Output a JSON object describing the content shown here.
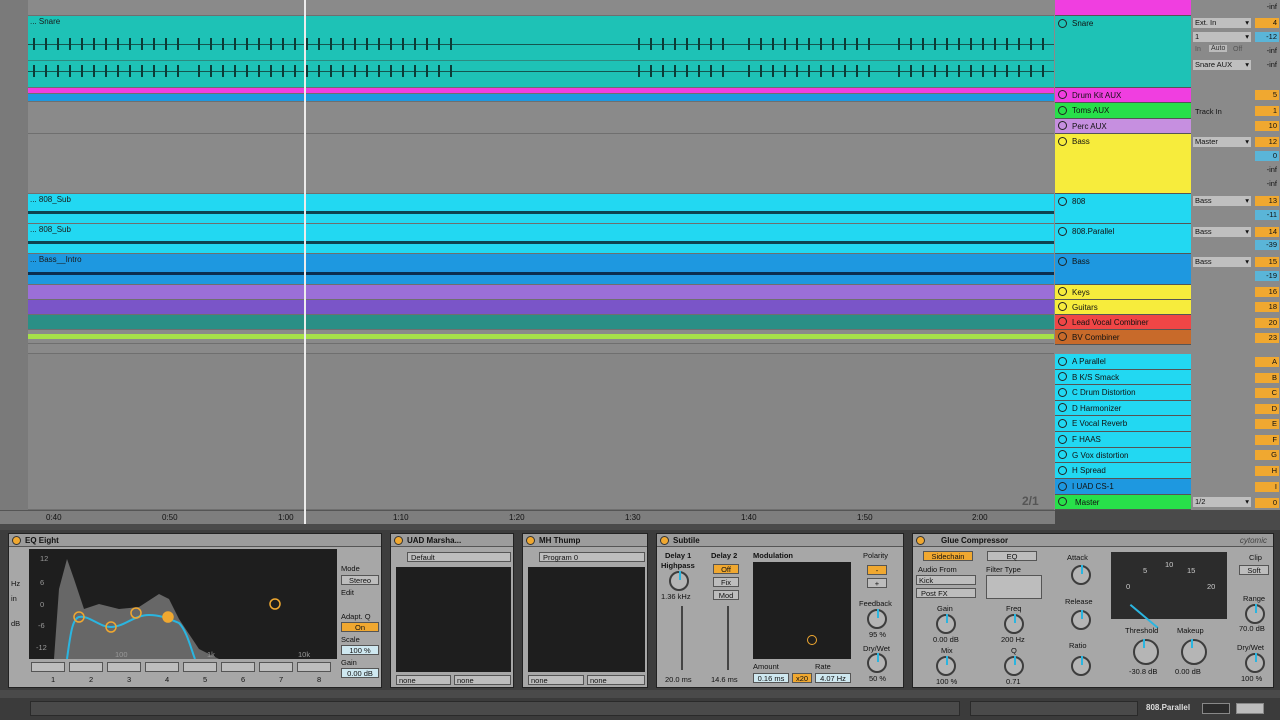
{
  "arrangement": {
    "ruler_ticks": [
      "0:40",
      "0:50",
      "1:00",
      "1:10",
      "1:20",
      "1:30",
      "1:40",
      "1:50",
      "2:00"
    ],
    "clip_names": {
      "snare": "... Snare",
      "sub1": "... 808_Sub",
      "sub2": "... 808_Sub",
      "bass": "... Bass__Intro"
    },
    "page_indicator": "2/1"
  },
  "tracks": [
    {
      "name": "Snare",
      "color": "#f03ee0"
    },
    {
      "name": "Snare",
      "color": "#1ec2b6"
    },
    {
      "name": "Drum Kit AUX",
      "color": "#f03ee0"
    },
    {
      "name": "Toms AUX",
      "color": "#28e04a"
    },
    {
      "name": "Perc AUX",
      "color": "#c68fe0"
    },
    {
      "name": "Bass",
      "color": "#f7ec3c"
    },
    {
      "name": "808",
      "color": "#22d8f2"
    },
    {
      "name": "808.Parallel",
      "color": "#22d8f2"
    },
    {
      "name": "Bass",
      "color": "#1e98e0"
    },
    {
      "name": "Keys",
      "color": "#f7ec3c"
    },
    {
      "name": "Guitars",
      "color": "#f7ec3c"
    },
    {
      "name": "Lead Vocal Combiner",
      "color": "#f04646"
    },
    {
      "name": "BV Combiner",
      "color": "#c86a2a"
    }
  ],
  "returns": [
    {
      "name": "A Parallel",
      "vol": "A"
    },
    {
      "name": "B K/S Smack",
      "vol": "B"
    },
    {
      "name": "C Drum Distortion",
      "vol": "C"
    },
    {
      "name": "D Harmonizer",
      "vol": "D"
    },
    {
      "name": "E Vocal Reverb",
      "vol": "E"
    },
    {
      "name": "F HAAS",
      "vol": "F"
    },
    {
      "name": "G Vox distortion",
      "vol": "G"
    },
    {
      "name": "H Spread",
      "vol": "H"
    },
    {
      "name": "I UAD CS-1",
      "vol": "I"
    }
  ],
  "master": {
    "name": "Master",
    "out": "1/2",
    "vol": "0"
  },
  "io": {
    "snare_in": "Ext. In",
    "snare_ch": "1",
    "monitor": [
      "In",
      "Auto",
      "Off"
    ],
    "snare_out": "Snare AUX",
    "toms_in": "Track In",
    "bass_out": "Master",
    "bass_808": "Bass",
    "bass_par": "Bass",
    "bass_bass": "Bass"
  },
  "volumes": [
    "-inf",
    "4",
    "-12",
    "-inf",
    "-inf",
    "5",
    "1",
    "10",
    "12",
    "0",
    "-inf",
    "-inf",
    "13",
    "-11",
    "14",
    "-39",
    "15",
    "-19",
    "16",
    "18",
    "20",
    "23"
  ],
  "devices": {
    "eq": {
      "title": "EQ Eight",
      "mode_label": "Mode",
      "mode": "Stereo",
      "edit": "Edit",
      "adapt": "Adapt. Q",
      "on": "On",
      "scale_label": "Scale",
      "scale": "100 %",
      "gain_label": "Gain",
      "gain": "0.00 dB",
      "y_labels": [
        "12",
        "6",
        "0",
        "-6",
        "-12"
      ],
      "x_labels": [
        "100",
        "1k",
        "10k"
      ],
      "bands": [
        "1",
        "2",
        "3",
        "4",
        "5",
        "6",
        "7",
        "8"
      ],
      "side": [
        "Hz",
        "in",
        "dB"
      ]
    },
    "uad": {
      "title": "UAD Marsha...",
      "preset": "Default",
      "none1": "none",
      "none2": "none"
    },
    "thump": {
      "title": "MH Thump",
      "preset": "Program 0",
      "none1": "none",
      "none2": "none"
    },
    "subtile": {
      "title": "Subtile",
      "d1": "Delay 1",
      "hp": "Highpass",
      "hp_val": "1.36 kHz",
      "d2": "Delay 2",
      "off": "Off",
      "fix": "Fix",
      "mod_btn": "Mod",
      "mod": "Modulation",
      "polarity": "Polarity",
      "minus": "-",
      "plus": "+",
      "feedback": "Feedback",
      "fb_val": "95 %",
      "drywet": "Dry/Wet",
      "dw_val": "50 %",
      "amount": "Amount",
      "amount_val": "0.16 ms",
      "amount_x": "x20",
      "rate": "Rate",
      "rate_val": "4.07 Hz",
      "d1_ms": "20.0 ms",
      "d2_ms": "14.6 ms"
    },
    "glue": {
      "title": "Glue Compressor",
      "brand": "cytomic",
      "sidechain": "Sidechain",
      "eq": "EQ",
      "audio_from": "Audio From",
      "kick": "Kick",
      "postfx": "Post FX",
      "filter_type": "Filter Type",
      "gain": "Gain",
      "gain_val": "0.00 dB",
      "freq": "Freq",
      "freq_val": "200 Hz",
      "mix": "Mix",
      "mix_val": "100 %",
      "q": "Q",
      "q_val": "0.71",
      "attack": "Attack",
      "release": "Release",
      "ratio": "Ratio",
      "threshold": "Threshold",
      "thr_val": "-30.8 dB",
      "makeup": "Makeup",
      "mk_val": "0.00 dB",
      "clip": "Clip",
      "soft": "Soft",
      "range": "Range",
      "range_val": "70.0 dB",
      "drywet": "Dry/Wet",
      "dw_val": "100 %",
      "meter": [
        "0",
        "5",
        "10",
        "15",
        "20"
      ]
    }
  },
  "status": {
    "track": "808.Parallel"
  }
}
